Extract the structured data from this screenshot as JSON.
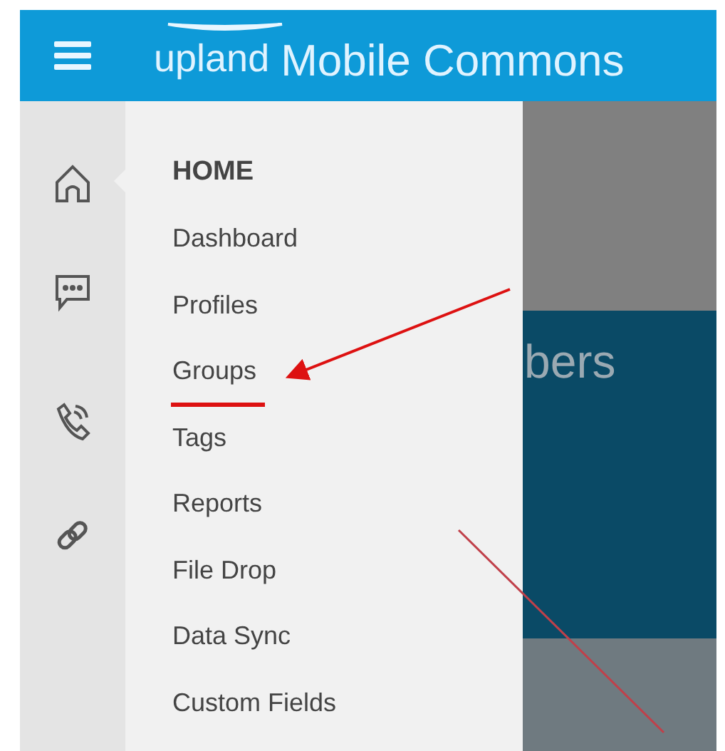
{
  "header": {
    "brand": "upland",
    "product": "Mobile Commons"
  },
  "menu": {
    "heading": "HOME",
    "items": [
      "Dashboard",
      "Profiles",
      "Groups",
      "Tags",
      "Reports",
      "File Drop",
      "Data Sync",
      "Custom Fields"
    ]
  },
  "content": {
    "banner_text": "bers"
  }
}
